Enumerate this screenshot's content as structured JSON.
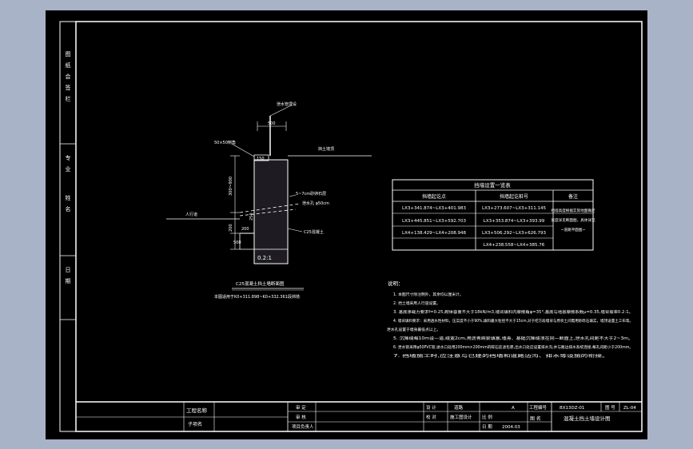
{
  "colors": {
    "viewport_background": "#a8b3c8",
    "drawing_background": "#000000",
    "line": "#ffffff"
  },
  "section": {
    "pipe_label": "泄水管埋设",
    "dim_top": "500",
    "cap_label": "50×50倒角",
    "cap_dim": "150",
    "height_dim": "300～900",
    "upper_ground_label": "挡土墙顶",
    "sand_label": "5~7cm砂卵石层",
    "drain_label": "泄水孔 φ50cm",
    "lower_ground_label": "人行道",
    "dim_a": "250",
    "dim_b": "200",
    "dim_c": "500",
    "dim_d": "200",
    "wall_material": "C25混凝土",
    "slope": "0.2:1",
    "caption_title": "C25混凝土挡土墙断面图",
    "caption_sub": "本图适用于K0+311.898~K0+332.361段挡墙"
  },
  "table": {
    "title": "挡墙设置一览表",
    "headers": [
      "挡墙起讫点",
      "挡墙起讫桩号",
      "备注"
    ],
    "rows": [
      [
        "LX3+341.874~LX3+401.983",
        "LX3+273.607~LX3+311.145"
      ],
      [
        "LX3+445.851~LX3+592.703",
        "LX3+353.874~LX3+393.99"
      ],
      [
        "LX4+138.429~LX4+208.948",
        "LX3+506.292~LX3+626.793"
      ],
      [
        "",
        "LX4+238.558~LX4+385.76"
      ]
    ],
    "remark": [
      "挡墙高度根据实际地面确定",
      "宽度详见断面图，具体详见",
      "~道路平面图~"
    ]
  },
  "notes": {
    "heading": "说明：",
    "items": [
      "1. 本图尺寸除注明外，其余均以厘米计。",
      "2. 挡土墙采用人行道设置。",
      "3. 基底承载力要求f=0.25,砌体容重不大于18kN/m3,墙背填料内摩擦角φ=35°,基底与地基摩擦系数μ=0.35,墙背坡率0.2:1。",
      "4. 墙背填料要求：采用透水性材料，压实度不小于90%,填料最大粒径不大于15cm,对于挖方段墙背与原状土间需用砂砾石填实，墙顶设置土工布等。",
      "   泄水孔设置于墙身最低点以上。",
      "5. 沉降缝每10m设一道,缝宽2cm,用沥青麻絮填塞,墙身、基础沉降缝须在同一断面上,泄水孔间距不大于2~3m。",
      "6. 泄水管采用φ50PVC管,进水口处用200mm×200mm的碎石反滤包裹,出水口处应设置排水沟,并与路边排水系统连接,每孔间距小于200mm。",
      "7. 挡墙施工时,应注意与已建的挡墙和道路边沟、排水等设施的衔接。"
    ]
  },
  "side_strip": [
    "图",
    "纸",
    "会",
    "签",
    "栏",
    "专",
    "业",
    "姓",
    "名",
    "日",
    "期"
  ],
  "title_block": {
    "project_label": "工程名称",
    "subitem_label": "子项名",
    "review_label": "审 定",
    "review_sub": "项目负责人",
    "check_label": "审 核",
    "design_label": "设 计",
    "proofread_label": "校 对",
    "road_label": "道路",
    "design_unit": "施工图设计",
    "scale_label": "比 例",
    "date_label": "日 期",
    "phase_label": "A",
    "date_value": "2004.03",
    "project_no_label": "工程编号",
    "project_no": "BX13DZ-01",
    "drawing_no_label": "图 号",
    "drawing_no": "ZL-04",
    "drawing_name_label": "图 名",
    "drawing_name": "混凝土挡土墙设计图"
  }
}
